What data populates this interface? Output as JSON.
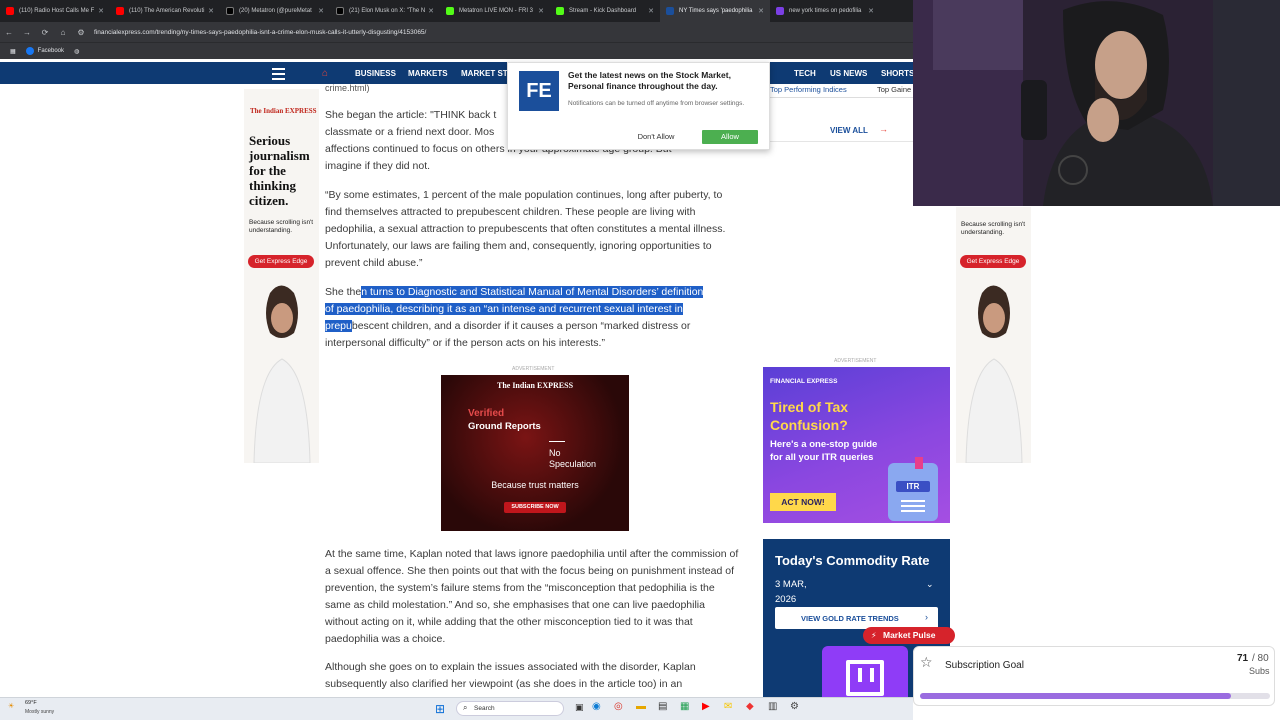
{
  "browser": {
    "tabs": [
      {
        "title": "(110) Radio Host Calls Me F",
        "color": "#ff0000"
      },
      {
        "title": "(110) The American Revoluti",
        "color": "#ff0000"
      },
      {
        "title": "(20) Metatron (@pureMetat",
        "color": "#000000"
      },
      {
        "title": "(21) Elon Musk on X: \"The N",
        "color": "#000000"
      },
      {
        "title": "Metatron LIVE MON - FRI 3",
        "color": "#53fc18"
      },
      {
        "title": "Stream - Kick Dashboard",
        "color": "#53fc18"
      },
      {
        "title": "NY Times says 'paedophilia",
        "color": "#1b4f9b"
      },
      {
        "title": "new york times on pedofilia",
        "color": "#7b3fe4"
      }
    ],
    "url": "financialexpress.com/trending/ny-times-says-paedophilia-isnt-a-crime-elon-musk-calls-it-utterly-disgusting/4153065/",
    "bookmark": "Facebook"
  },
  "site_nav": {
    "items": [
      "BUSINESS",
      "MARKETS",
      "MARKET ST",
      "TECH",
      "US NEWS",
      "SHORTS"
    ],
    "subnav": [
      "Top Performing Indices",
      "Top Gaine"
    ],
    "view_all": "VIEW ALL"
  },
  "notification": {
    "logo": "FE",
    "title": "Get the latest news on the Stock Market, Personal finance throughout the day.",
    "subtitle": "Notifications can be turned off anytime from browser settings.",
    "deny": "Don't Allow",
    "allow": "Allow"
  },
  "article": {
    "top_fragment": "crime.html)",
    "p1_a": "She began the article: \"THINK back t",
    "p1_b": "classmate or a friend next door. Mos",
    "p1_c": "affections continued to focus on others in your approximate age group. But",
    "p1_d": "imagine if they did not.",
    "p2": "“By some estimates, 1 percent of the male population continues, long after puberty, to find themselves attracted to prepubescent children. These people are living with pedophilia, a sexual attraction to prepubescents that often constitutes a mental illness. Unfortunately, our laws are failing them and, consequently, ignoring opportunities to prevent child abuse.”",
    "p3_pre": "She the",
    "p3_hl1": "n turns to Diagnostic and Statistical Manual of Mental Disorders’ definition",
    "p3_hl2": "of paedophilia, describing it as an “an intense and recurrent sexual interest in",
    "p3_hl3": "prepu",
    "p3_post": "bescent children, and a disorder if it causes a person “marked distress or",
    "p3_line4": "interpersonal difficulty” or if the person acts on his interests.”",
    "advert_label": "ADVERTISEMENT",
    "p4": "At the same time, Kaplan noted that laws ignore paedophilia until after the commission of a sexual offence. She then points out that with the focus being on punishment instead of prevention, the system’s failure stems from the “misconception that pedophilia is the same as child molestation.” And so, she emphasises that one can live paedophilia without acting on it, while adding that the other misconception tied to it was that paedophilia was a choice.",
    "p5": "Although she goes on to explain the issues associated with the disorder, Kaplan subsequently also clarified her viewpoint (as she does in the article too) in an"
  },
  "ads": {
    "side_logo": "The Indian EXPRESS",
    "side_headline": "Serious journalism for the thinking citizen.",
    "side_tagline": "Because scrolling isn't understanding.",
    "side_button": "Get Express Edge",
    "right_tagline": "Because scrolling isn't understanding.",
    "right_button": "Get Express Edge",
    "mid_logo": "The Indian EXPRESS",
    "mid_line1": "Verified",
    "mid_line2": "Ground Reports",
    "mid_line3": "No",
    "mid_line4": "Speculation",
    "mid_line5": "Because trust matters",
    "mid_button": "SUBSCRIBE NOW",
    "tax_logo": "FINANCIAL EXPRESS",
    "tax_headline": "Tired of Tax Confusion?",
    "tax_body": "Here's a one-stop guide for all your ITR queries",
    "tax_button": "ACT NOW!",
    "tax_badge": "ITR",
    "advert_label": "ADVERTISEMENT"
  },
  "commodity": {
    "title": "Today's Commodity Rate",
    "date": "3 MAR, 2026",
    "button": "VIEW GOLD RATE TRENDS",
    "pulse": "Market Pulse"
  },
  "stream_overlay": {
    "goal_title": "Subscription Goal",
    "goal_current": "71",
    "goal_target": "/ 80",
    "goal_unit": "Subs",
    "goal_progress": 0.8875
  },
  "taskbar": {
    "weather_temp": "69°F",
    "weather_desc": "Mostly sunny",
    "search": "Search"
  }
}
